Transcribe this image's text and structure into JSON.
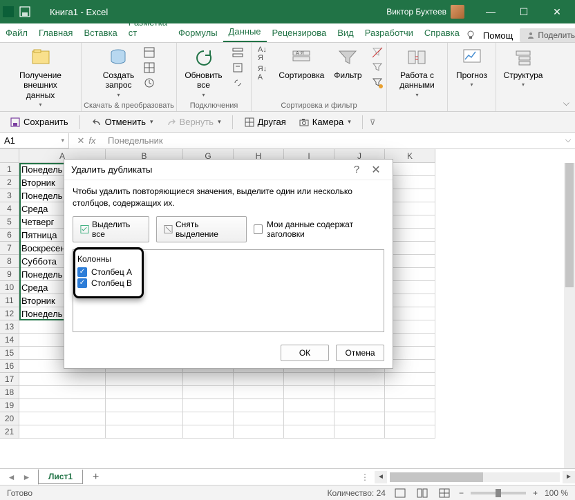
{
  "titlebar": {
    "title": "Книга1 - Excel",
    "user": "Виктор Бухтеев"
  },
  "tabs": [
    "Файл",
    "Главная",
    "Вставка",
    "Разметка ст",
    "Формулы",
    "Данные",
    "Рецензирова",
    "Вид",
    "Разработчи",
    "Справка"
  ],
  "activeTab": 5,
  "help_label": "Помощ",
  "share_label": "Поделиться",
  "ribbon": {
    "g1": {
      "btn": "Получение\nвнешних данных",
      "label": ""
    },
    "g2": {
      "btn": "Создать\nзапрос",
      "label": "Скачать & преобразовать"
    },
    "g3": {
      "btn": "Обновить\nвсе",
      "label": "Подключения"
    },
    "g4": {
      "sort": "Сортировка",
      "filter": "Фильтр",
      "label": "Сортировка и фильтр"
    },
    "g5": {
      "btn": "Работа с\nданными",
      "label": ""
    },
    "g6": {
      "btn": "Прогноз",
      "label": ""
    },
    "g7": {
      "btn": "Структура",
      "label": ""
    }
  },
  "qat2": {
    "save": "Сохранить",
    "undo": "Отменить",
    "redo": "Вернуть",
    "other": "Другая",
    "camera": "Камера"
  },
  "namebox": "A1",
  "formula": "Понедельник",
  "rows_data": [
    "Понедель",
    "Вторник",
    "Понедель",
    "Среда",
    "Четверг",
    "Пятница",
    "Воскресен",
    "Суббота",
    "Понедель",
    "Среда",
    "Вторник",
    "Понедель"
  ],
  "col_letters": [
    "A",
    "B",
    "G",
    "H",
    "I",
    "J",
    "K"
  ],
  "dialog": {
    "title": "Удалить дубликаты",
    "msg": "Чтобы удалить повторяющиеся значения, выделите один или несколько столбцов, содержащих их.",
    "select_all": "Выделить все",
    "deselect": "Снять выделение",
    "headers_cb": "Мои данные содержат заголовки",
    "cols_header": "Колонны",
    "colA": "Столбец A",
    "colB": "Столбец B",
    "ok": "ОК",
    "cancel": "Отмена"
  },
  "sheet_tab": "Лист1",
  "status": {
    "ready": "Готово",
    "count": "Количество: 24",
    "zoom": "100 %"
  }
}
